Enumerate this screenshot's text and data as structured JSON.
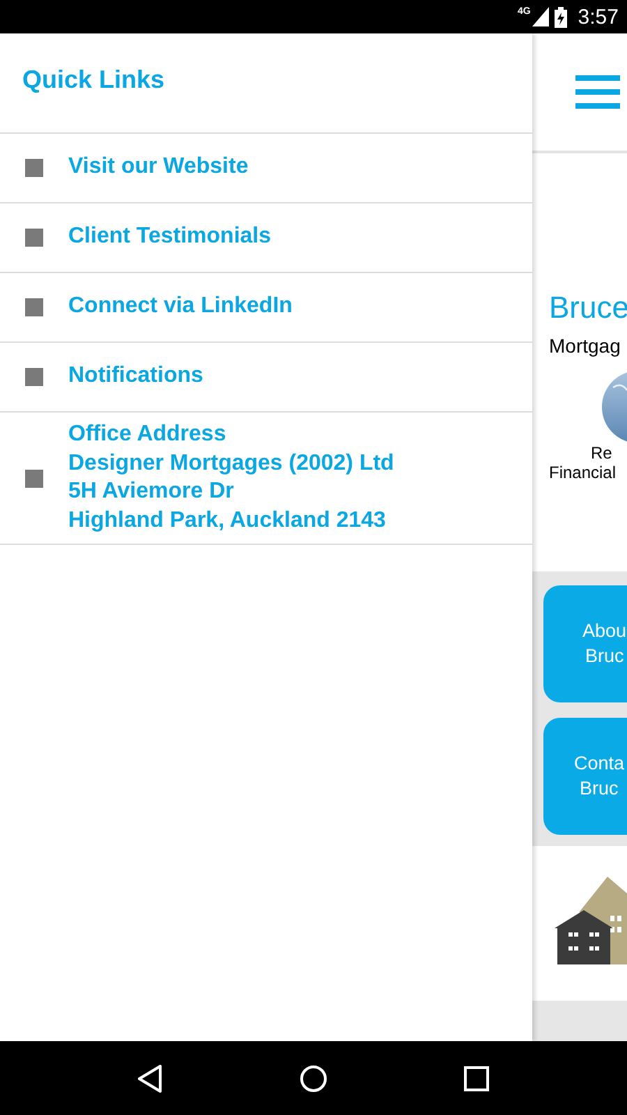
{
  "status_bar": {
    "network": "4G",
    "time": "3:57"
  },
  "drawer": {
    "title": "Quick Links",
    "items": [
      {
        "lines": [
          "Visit our Website"
        ]
      },
      {
        "lines": [
          "Client Testimonials"
        ]
      },
      {
        "lines": [
          "Connect via LinkedIn"
        ]
      },
      {
        "lines": [
          "Notifications"
        ]
      },
      {
        "lines": [
          "Office Address",
          "Designer Mortgages (2002) Ltd",
          "5H Aviemore Dr",
          "Highland Park, Auckland 2143"
        ]
      }
    ]
  },
  "page": {
    "heading": "Bruce",
    "subtitle": "Mortgag",
    "logo_caption": [
      "Re",
      "Financial"
    ],
    "buttons": [
      {
        "lines": [
          "Abou",
          "Bruc"
        ]
      },
      {
        "lines": [
          "Conta",
          "Bruc"
        ]
      }
    ]
  }
}
